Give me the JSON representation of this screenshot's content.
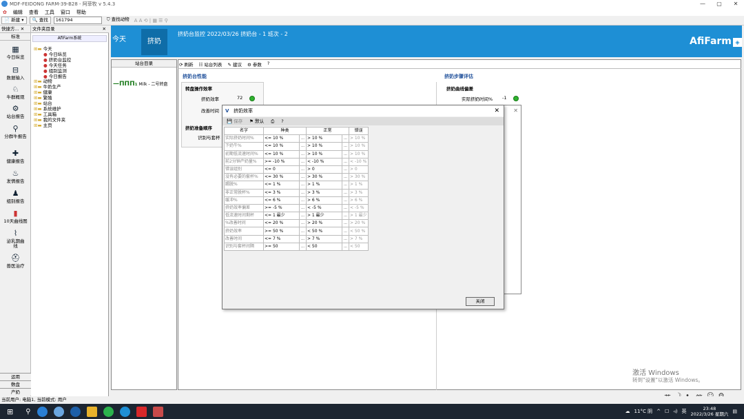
{
  "window": {
    "title": "MDF-FEIDONG FARM-39-B28 - 阿菲牧 v 5.4.3"
  },
  "menu": [
    "编辑",
    "查看",
    "工具",
    "窗口",
    "帮助"
  ],
  "toolbar": {
    "new": "新建",
    "find": "查找",
    "search_value": "161794",
    "find_animal": "查找动物"
  },
  "left_panel": {
    "header_quick": "快捷方...",
    "header_std": "标准",
    "items": [
      "今日纵览",
      "数据输入",
      "牛群概观",
      "站台报告",
      "分群牛报告",
      "健康报告",
      "发情报告",
      "组别报告",
      "10天曲线图",
      "泌乳期曲线",
      "兽医治疗"
    ],
    "bottom": [
      "运用",
      "敷盘",
      "产奶"
    ]
  },
  "file_tree": {
    "header": "文件夹目录",
    "root": "AfiFarm系统",
    "nodes": [
      {
        "label": "今天",
        "level": 0
      },
      {
        "label": "今日纵览",
        "level": 1
      },
      {
        "label": "挤奶台监控",
        "level": 1
      },
      {
        "label": "今天任务",
        "level": 1
      },
      {
        "label": "组别监测",
        "level": 1
      },
      {
        "label": "今日报告",
        "level": 1
      },
      {
        "label": "动物",
        "level": 0
      },
      {
        "label": "牛奶生产",
        "level": 0
      },
      {
        "label": "健康",
        "level": 0
      },
      {
        "label": "繁殖",
        "level": 0
      },
      {
        "label": "站台",
        "level": 0
      },
      {
        "label": "系统维护",
        "level": 0
      },
      {
        "label": "工具箱",
        "level": 0
      },
      {
        "label": "我的文件夹",
        "level": 0
      },
      {
        "label": "主页",
        "level": 0
      }
    ]
  },
  "header": {
    "tab_today": "今天",
    "tab_milking": "挤奶",
    "title": "挤奶台监控 2022/03/26 挤奶台 - 1 班次 - 2",
    "logo": "AfiFarm"
  },
  "station_list": {
    "title": "站台目录",
    "item": "Milk - 二号转盘"
  },
  "subtoolbar": {
    "refresh": "刷新",
    "station_list": "站台列表",
    "advice": "建议",
    "params": "参数"
  },
  "panel_left": {
    "title": "挤奶台性能",
    "section": "转盘操作效率",
    "row1_label": "挤奶效率",
    "row1_value": "72",
    "row2_label": "改善时间",
    "section2": "挤奶准备顺序",
    "row3_label": "识别与套杯"
  },
  "panel_right": {
    "title": "挤奶步骤评估",
    "section": "挤奶曲线偏差",
    "row1_label": "实际挤奶时间%",
    "row1_value": "-1"
  },
  "dialog": {
    "title": "挤奶效率",
    "toolbar": {
      "save": "保存",
      "default": "默认"
    },
    "columns": [
      "名字",
      "种类",
      "正常",
      "错误"
    ],
    "rows": [
      [
        "实际挤奶时间%",
        "<= 10 %",
        "> 10 %",
        "> 10 %"
      ],
      [
        "下奶牛%",
        "<= 10 %",
        "> 10 %",
        "> 10 %"
      ],
      [
        "初期低流速时间%",
        "<= 10 %",
        "> 10 %",
        "> 10 %"
      ],
      [
        "前2分钟产奶量%",
        ">= -10 %",
        "< -10 %",
        "< -10 %"
      ],
      [
        "错误组别",
        "<= 0",
        "> 0",
        "> 0"
      ],
      [
        "没有必要的套杯%",
        "<= 30 %",
        "> 30 %",
        "> 30 %"
      ],
      [
        "踢脱%",
        "<= 1 %",
        "> 1 %",
        "> 1 %"
      ],
      [
        "非正常脱杯%",
        "<= 3 %",
        "> 3 %",
        "> 3 %"
      ],
      [
        "缓冲%",
        "<= 6 %",
        "> 6 %",
        "> 6 %"
      ],
      [
        "挤奶效率偏差",
        ">= -5 %",
        "< -5 %",
        "< -5 %"
      ],
      [
        "低流速时间剩杯",
        "<= 1 最少",
        "> 1 最少",
        "> 1 最少"
      ],
      [
        "%改善时间",
        "<= 20 %",
        "> 20 %",
        "> 20 %"
      ],
      [
        "挤奶效率",
        ">= 50 %",
        "< 50 %",
        "< 50 %"
      ],
      [
        "改善时间",
        "<= 7 %",
        "> 7 %",
        "> 7 %"
      ],
      [
        "识别与套杯间隔",
        ">= 50",
        "< 50",
        "< 50"
      ]
    ],
    "close": "关闭"
  },
  "statusbar": "当前用户: 电脑1, 当前模式: 用户",
  "watermark": {
    "line1": "激活 Windows",
    "line2": "转到\"设置\"以激活 Windows。"
  },
  "ime": [
    "英",
    "简"
  ],
  "tray": {
    "weather": "11°C 阴",
    "ime": "英",
    "time": "23:48",
    "date": "2022/3/26 星期六"
  }
}
